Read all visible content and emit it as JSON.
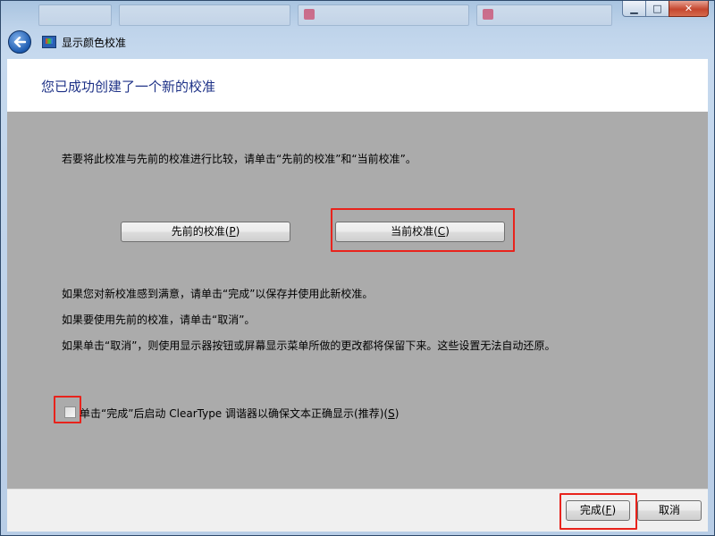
{
  "window": {
    "title": "显示颜色校准",
    "caption_minimize": "▁",
    "caption_maximize": "□",
    "caption_close": "✕"
  },
  "header": {
    "title": "您已成功创建了一个新的校准"
  },
  "content": {
    "compare_instruction": "若要将此校准与先前的校准进行比较，请单击“先前的校准”和“当前校准”。",
    "previous_button": {
      "text": "先前的校准(",
      "key": "P",
      "close": ")"
    },
    "current_button": {
      "text": "当前校准(",
      "key": "C",
      "close": ")"
    },
    "info_lines": [
      "如果您对新校准感到满意，请单击“完成”以保存并使用此新校准。",
      "如果要使用先前的校准，请单击“取消”。",
      "如果单击“取消”，则使用显示器按钮或屏幕显示菜单所做的更改都将保留下来。这些设置无法自动还原。"
    ],
    "cleartype_checkbox": {
      "text": "单击“完成”后启动 ClearType 调谐器以确保文本正确显示(推荐)(",
      "key": "S",
      "close": ")",
      "checked": false
    }
  },
  "footer": {
    "finish_button": {
      "text": "完成(",
      "key": "F",
      "close": ")"
    },
    "cancel_button": {
      "text": "取消"
    }
  },
  "colors": {
    "highlight": "#e8231c",
    "header_text": "#1e3287",
    "body_bg": "#ababab"
  },
  "icons": {
    "back": "back-arrow-icon",
    "app": "display-calibration-icon"
  }
}
